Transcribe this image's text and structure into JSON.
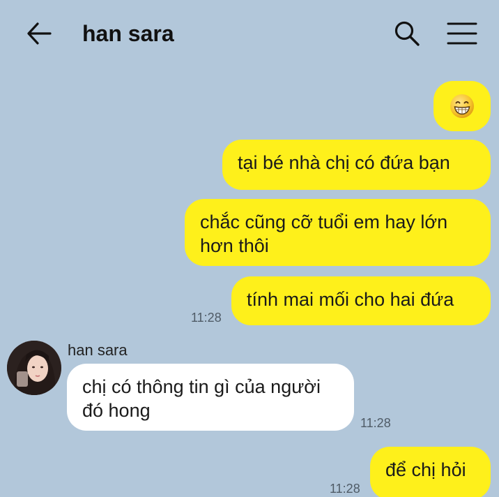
{
  "header": {
    "title": "han sara",
    "back_icon": "arrow-left-icon",
    "search_icon": "search-icon",
    "menu_icon": "hamburger-menu-icon"
  },
  "colors": {
    "background": "#b2c7da",
    "my_bubble": "#fef01b",
    "their_bubble": "#ffffff"
  },
  "messages": [
    {
      "from": "me",
      "type": "emoji",
      "emoji": "grinning-face-icon"
    },
    {
      "from": "me",
      "text": "tại bé nhà chị có đứa bạn"
    },
    {
      "from": "me",
      "text": "chắc cũng cỡ tuổi em hay lớn hơn thôi"
    },
    {
      "from": "me",
      "text": "tính mai mối cho hai đứa",
      "time": "11:28"
    },
    {
      "from": "them",
      "sender": "han sara",
      "text": "chị có thông tin gì của người đó hong",
      "time": "11:28"
    },
    {
      "from": "me",
      "text": "để chị hỏi",
      "time": "11:28"
    }
  ]
}
